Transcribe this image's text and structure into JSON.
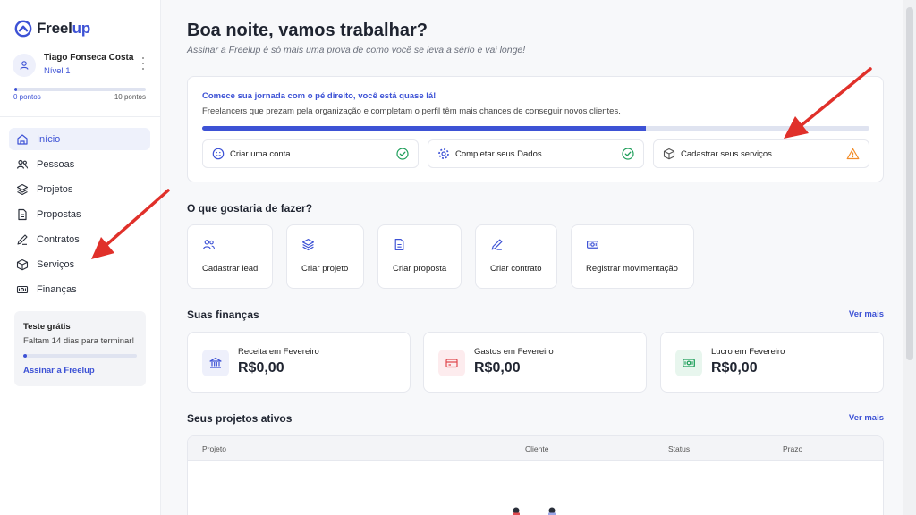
{
  "brand": {
    "prefix": "Freel",
    "accent": "up"
  },
  "user": {
    "name": "Tiago Fonseca Costa",
    "level": "Nível 1",
    "points_min": "0 pontos",
    "points_max": "10 pontos",
    "points_progress": 0.02
  },
  "nav": [
    {
      "label": "Início",
      "icon": "home-icon",
      "active": true
    },
    {
      "label": "Pessoas",
      "icon": "users-icon"
    },
    {
      "label": "Projetos",
      "icon": "layers-icon"
    },
    {
      "label": "Propostas",
      "icon": "document-icon"
    },
    {
      "label": "Contratos",
      "icon": "pen-icon"
    },
    {
      "label": "Serviços",
      "icon": "box-icon"
    },
    {
      "label": "Finanças",
      "icon": "money-icon"
    }
  ],
  "trial": {
    "title": "Teste grátis",
    "subtitle": "Faltam 14 dias para terminar!",
    "link": "Assinar a Freelup",
    "progress": 0.03
  },
  "header": {
    "greeting": "Boa noite, vamos trabalhar?",
    "subtitle": "Assinar a Freelup é só mais uma prova de como você se leva a sério e vai longe!"
  },
  "journey": {
    "title": "Comece sua jornada com o pé direito, você está quase lá!",
    "subtitle": "Freelancers que prezam pela organização e completam o perfil têm mais chances de conseguir novos clientes.",
    "progress": 0.665,
    "steps": [
      {
        "label": "Criar uma conta",
        "icon": "smile-icon",
        "status": "done"
      },
      {
        "label": "Completar seus Dados",
        "icon": "gear-icon",
        "status": "done"
      },
      {
        "label": "Cadastrar seus serviços",
        "icon": "box-icon",
        "status": "warning"
      }
    ]
  },
  "actions": {
    "title": "O que gostaria de fazer?",
    "items": [
      {
        "label": "Cadastrar lead",
        "icon": "users-icon"
      },
      {
        "label": "Criar projeto",
        "icon": "layers-icon"
      },
      {
        "label": "Criar proposta",
        "icon": "document-icon"
      },
      {
        "label": "Criar contrato",
        "icon": "pen-icon"
      },
      {
        "label": "Registrar movimentação",
        "icon": "money-icon"
      }
    ]
  },
  "finances": {
    "title": "Suas finanças",
    "see_more": "Ver mais",
    "cards": [
      {
        "label": "Receita em Fevereiro",
        "value": "R$0,00",
        "icon": "bank-icon",
        "color": "#3d52d5"
      },
      {
        "label": "Gastos em Fevereiro",
        "value": "R$0,00",
        "icon": "credit-card-icon",
        "color": "#e0484e"
      },
      {
        "label": "Lucro em Fevereiro",
        "value": "R$0,00",
        "icon": "money-icon",
        "color": "#1e9e5a"
      }
    ]
  },
  "projects": {
    "title": "Seus projetos ativos",
    "see_more": "Ver mais",
    "columns": [
      "Projeto",
      "Cliente",
      "Status",
      "Prazo"
    ]
  },
  "colors": {
    "accent": "#3d52d5",
    "success": "#1e9e5a",
    "warning": "#f28c28",
    "annotation": "#e0302a"
  }
}
